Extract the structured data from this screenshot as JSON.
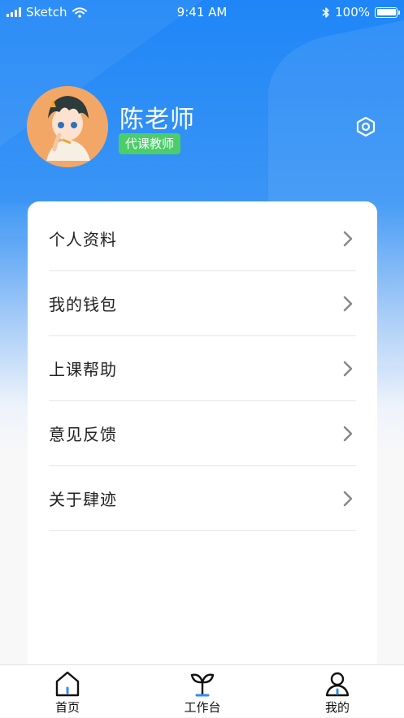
{
  "status_bar": {
    "carrier": "Sketch",
    "time": "9:41 AM",
    "battery": "100%",
    "battery_level": 1.0
  },
  "profile": {
    "name": "陈老师",
    "role": "代课教师",
    "avatar_icon": "anime-avatar-icon"
  },
  "header": {
    "settings_icon": "hexagon-settings-icon"
  },
  "menu": {
    "items": [
      {
        "label": "个人资料"
      },
      {
        "label": "我的钱包"
      },
      {
        "label": "上课帮助"
      },
      {
        "label": "意见反馈"
      },
      {
        "label": "关于肆迹"
      }
    ]
  },
  "tab_bar": {
    "tabs": [
      {
        "label": "首页",
        "icon": "home-icon"
      },
      {
        "label": "工作台",
        "icon": "sprout-icon"
      },
      {
        "label": "我的",
        "icon": "person-icon"
      }
    ]
  },
  "colors": {
    "primary_blue": "#1f86f7",
    "badge_green": "#4bcd6a",
    "tab_accent": "#2e8cf6"
  }
}
